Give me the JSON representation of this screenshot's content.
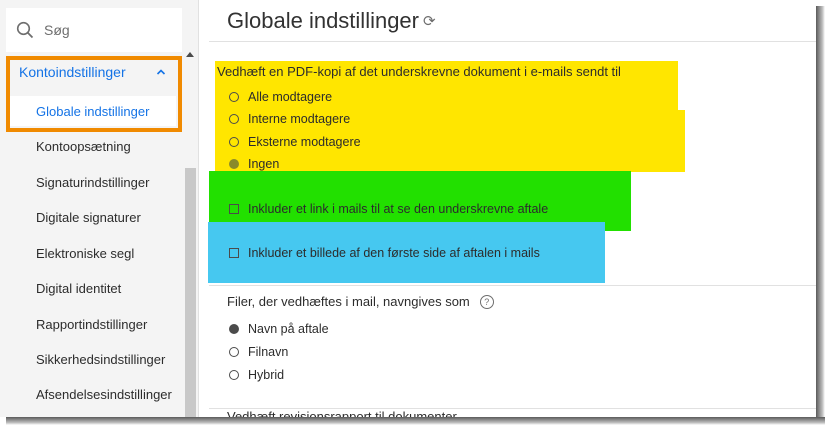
{
  "sidebar": {
    "search_placeholder": "Søg",
    "parent_label": "Kontoindstillinger",
    "active_item": "Globale indstillinger",
    "items": [
      "Kontoopsætning",
      "Signaturindstillinger",
      "Digitale signaturer",
      "Elektroniske segl",
      "Digital identitet",
      "Rapportindstillinger",
      "Sikkerhedsindstillinger",
      "Afsendelsesindstillinger"
    ]
  },
  "main": {
    "title": "Globale indstillinger",
    "pdf_section": {
      "heading": "Vedhæft en PDF-kopi af det underskrevne dokument i e-mails sendt til",
      "options": [
        {
          "label": "Alle modtagere",
          "selected": false
        },
        {
          "label": "Interne modtagere",
          "selected": false
        },
        {
          "label": "Eksterne modtagere",
          "selected": false
        },
        {
          "label": "Ingen",
          "selected": true
        }
      ]
    },
    "checkboxes": [
      {
        "label": "Inkluder et link i mails til at se den underskrevne aftale",
        "checked": false
      },
      {
        "label": "Inkluder et billede af den første side af aftalen i mails",
        "checked": false
      }
    ],
    "naming_section": {
      "heading": "Filer, der vedhæftes i mail, navngives som",
      "help": "?",
      "options": [
        {
          "label": "Navn på aftale",
          "selected": true
        },
        {
          "label": "Filnavn",
          "selected": false
        },
        {
          "label": "Hybrid",
          "selected": false
        }
      ]
    },
    "partial_heading": "Vedhæft revisionsrapport til dokumenter"
  },
  "colors": {
    "accent": "#1473e6",
    "highlight_orange": "#f08a00",
    "highlight_yellow": "#ffe600",
    "highlight_green": "#22e000",
    "highlight_blue": "#46c8f0"
  }
}
